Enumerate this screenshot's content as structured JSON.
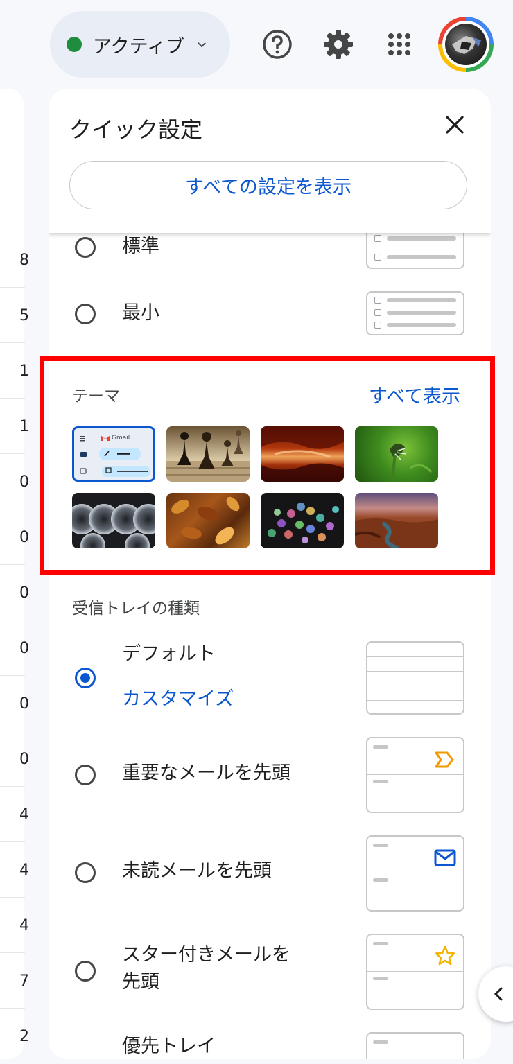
{
  "header": {
    "status_label": "アクティブ",
    "status_color": "#1e8e3e",
    "icons": [
      "help-icon",
      "gear-icon",
      "apps-grid-icon"
    ]
  },
  "left_list": {
    "digits": [
      "8",
      "5",
      "1",
      "1",
      "0",
      "0",
      "0",
      "0",
      "0",
      "0",
      "4",
      "4",
      "4",
      "7",
      "2"
    ]
  },
  "quick_settings": {
    "title": "クイック設定",
    "all_settings_button": "すべての設定を表示",
    "density": {
      "options": [
        {
          "label": "標準",
          "checked": false
        },
        {
          "label": "最小",
          "checked": false
        }
      ]
    },
    "theme": {
      "label": "テーマ",
      "view_all": "すべて表示",
      "default_tile_brand": "Gmail",
      "tiles": [
        "default",
        "chess",
        "canyon",
        "flower",
        "pipes",
        "leaves",
        "bokeh",
        "river"
      ]
    },
    "inbox_type": {
      "label": "受信トレイの種類",
      "options": [
        {
          "label": "デフォルト",
          "checked": true,
          "link": "カスタマイズ"
        },
        {
          "label": "重要なメールを先頭",
          "checked": false
        },
        {
          "label": "未読メールを先頭",
          "checked": false
        },
        {
          "label": "スター付きメールを先頭",
          "label_line1": "スター付きメールを",
          "label_line2": "先頭",
          "checked": false
        },
        {
          "label": "優先トレイ",
          "checked": false
        }
      ]
    }
  },
  "colors": {
    "accent": "#0b57d0",
    "highlight": "#ff0000"
  }
}
